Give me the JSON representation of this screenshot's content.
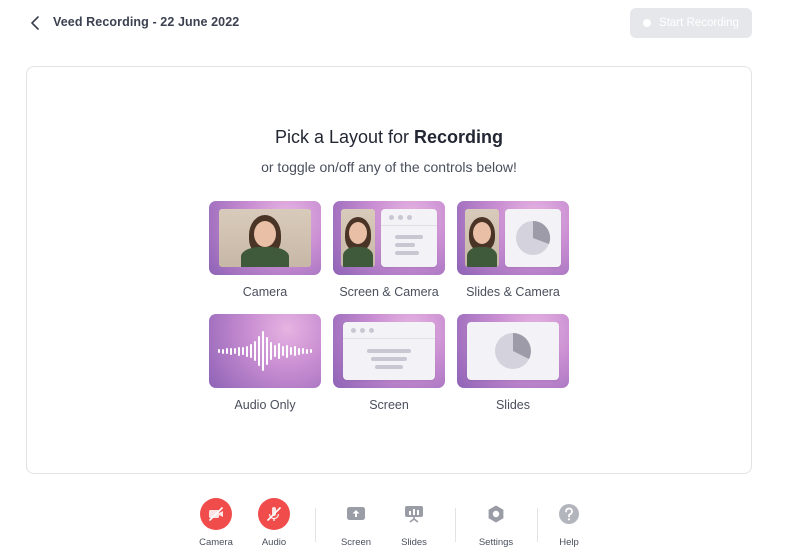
{
  "header": {
    "title": "Veed Recording - 22 June 2022",
    "start_button": "Start Recording"
  },
  "main": {
    "heading_prefix": "Pick a Layout for ",
    "heading_bold": "Recording",
    "subheading": "or toggle on/off any of the controls below!",
    "layouts": [
      {
        "label": "Camera"
      },
      {
        "label": "Screen & Camera"
      },
      {
        "label": "Slides & Camera"
      },
      {
        "label": "Audio Only"
      },
      {
        "label": "Screen"
      },
      {
        "label": "Slides"
      }
    ]
  },
  "toolbar": {
    "items": [
      {
        "label": "Camera",
        "icon": "camera-off-icon"
      },
      {
        "label": "Audio",
        "icon": "mic-off-icon"
      },
      {
        "label": "Screen",
        "icon": "screen-share-icon"
      },
      {
        "label": "Slides",
        "icon": "slides-icon"
      },
      {
        "label": "Settings",
        "icon": "gear-icon"
      },
      {
        "label": "Help",
        "icon": "help-icon"
      }
    ]
  },
  "colors": {
    "accent_red": "#f04c4c",
    "tile_gradient_light": "#e6b4e2",
    "tile_gradient_dark": "#8f63b6",
    "disabled_button": "#e6e7ea"
  }
}
